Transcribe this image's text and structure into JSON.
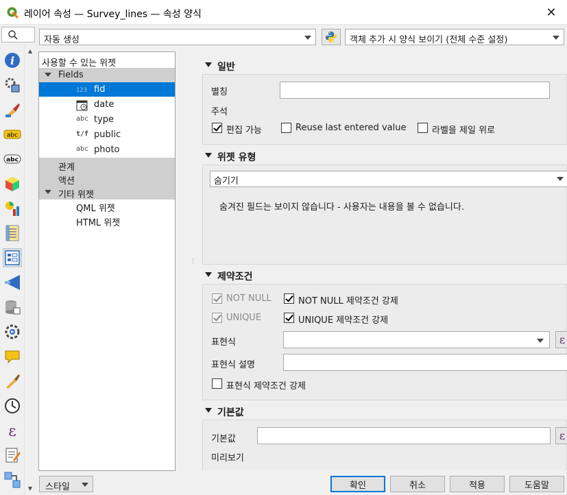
{
  "window": {
    "title": "레이어 속성 — Survey_lines — 속성 양식",
    "close_glyph": "✕"
  },
  "toolbar_top": {
    "layout_combo_value": "자동 생성",
    "suppress_combo_value": "객체 추가 시 양식 보이기 (전체 수준 설정)"
  },
  "left_toolbar": {
    "icons": [
      "information-icon",
      "source-icon",
      "symbology-icon",
      "labels-icon",
      "masks-icon",
      "3d-view-icon",
      "diagrams-icon",
      "fields-icon",
      "attributes-form-icon",
      "joins-icon",
      "auxiliary-storage-icon",
      "actions-icon",
      "display-icon",
      "rendering-icon",
      "temporal-icon",
      "variables-icon",
      "metadata-icon",
      "dependencies-icon"
    ]
  },
  "tree": {
    "header": "사용할 수 있는 위젯",
    "fields_label": "Fields",
    "fields": [
      {
        "type": "",
        "name": "fid"
      },
      {
        "type": "",
        "name": "date"
      },
      {
        "type": "abc",
        "name": "type"
      },
      {
        "type": "t/f",
        "name": "public"
      },
      {
        "type": "abc",
        "name": "photo"
      }
    ],
    "relations_label": "관계",
    "actions_label": "액션",
    "other_label": "기타 위젯",
    "other_items": [
      "QML 위젯",
      "HTML 위젯"
    ]
  },
  "general": {
    "title": "일반",
    "alias_label": "별칭",
    "alias_value": "",
    "comment_label": "주석",
    "editable_label": "편집 가능",
    "editable": true,
    "reuse_label": "Reuse last entered value",
    "reuse": false,
    "label_on_top_label": "라벨을 제일 위로",
    "label_on_top": false
  },
  "widget_type": {
    "title": "위젯 유형",
    "selected": "숨기기",
    "description": "숨겨진 필드는 보이지 않습니다 - 사용자는 내용을 볼 수 없습니다."
  },
  "constraints": {
    "title": "제약조건",
    "not_null_label": "NOT NULL",
    "not_null": true,
    "enforce_not_null_label": "NOT NULL 제약조건 강제",
    "enforce_not_null": true,
    "unique_label": "UNIQUE",
    "unique": true,
    "enforce_unique_label": "UNIQUE 제약조건 강제",
    "enforce_unique": true,
    "expression_label": "표현식",
    "expression_value": "",
    "expression_desc_label": "표현식 설명",
    "expression_desc_value": "",
    "enforce_expr_label": "표현식 제약조건 강제",
    "enforce_expr": false,
    "expr_button_glyph": "ε"
  },
  "defaults": {
    "title": "기본값",
    "default_label": "기본값",
    "default_value": "",
    "preview_label": "미리보기"
  },
  "buttons": {
    "style": "스타일",
    "ok": "확인",
    "cancel": "취소",
    "apply": "적용",
    "help": "도움말"
  },
  "colors": {
    "selection": "#0078d7",
    "group_bg": "#cfcfcf",
    "section_bg": "#ececec"
  }
}
